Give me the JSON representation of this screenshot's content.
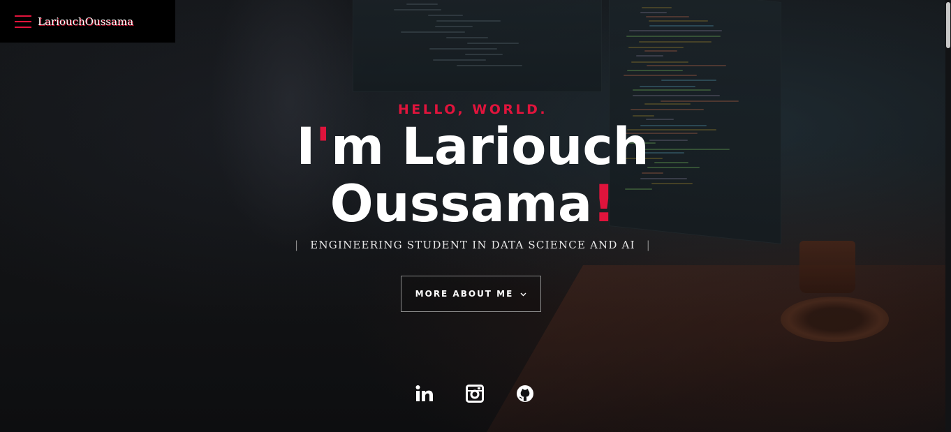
{
  "brand": {
    "name": "LariouchOussama",
    "accent": "#e0143c",
    "menu_icon": "hamburger-icon"
  },
  "hero": {
    "greeting": "HELLO, WORLD.",
    "headline_pre": "I",
    "headline_apostrophe": "'",
    "headline_line1_rest": "m Lariouch",
    "headline_line2": "Oussama",
    "headline_exclaim": "!",
    "subtitle": "ENGINEERING STUDENT IN DATA SCIENCE AND AI",
    "subtitle_divider_left": "|",
    "subtitle_divider_right": "|",
    "cta_label": "MORE ABOUT ME",
    "cta_icon": "chevron-down-icon"
  },
  "social": [
    {
      "name": "LinkedIn",
      "icon": "linkedin-icon"
    },
    {
      "name": "Instagram",
      "icon": "instagram-icon"
    },
    {
      "name": "GitHub",
      "icon": "github-icon"
    }
  ],
  "colors": {
    "accent": "#e0143c",
    "text": "#ffffff",
    "background": "#111214"
  }
}
